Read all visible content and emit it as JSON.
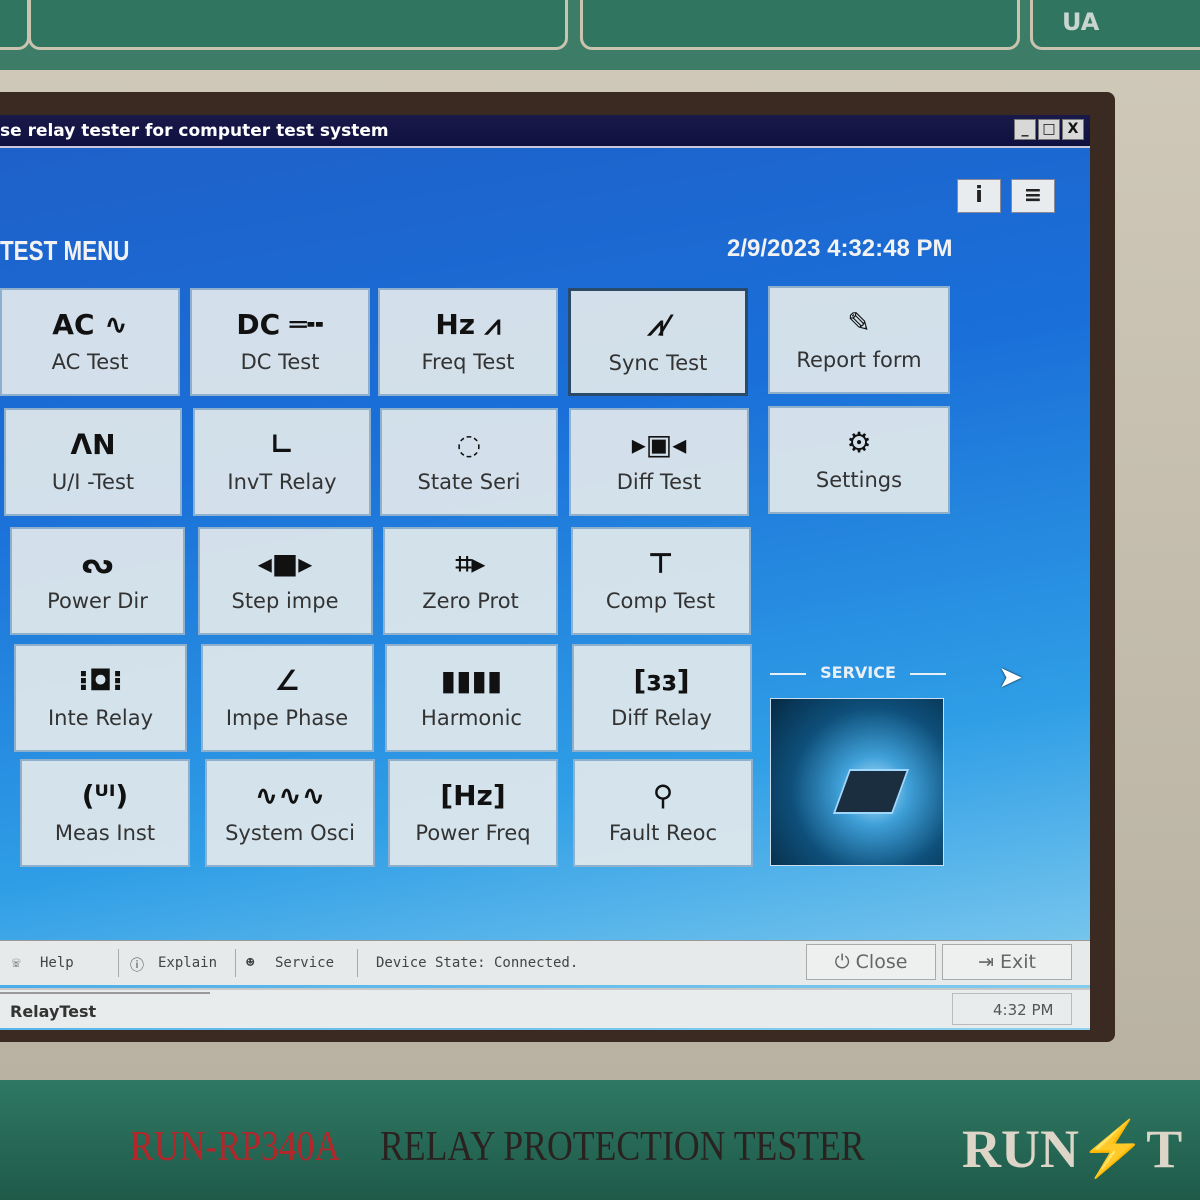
{
  "device": {
    "top_label": "UA",
    "model": "RUN-RP340A",
    "product": "RELAY PROTECTION TESTER",
    "logo": "RUN⚡T"
  },
  "window": {
    "title": "se relay tester for computer test system",
    "controls": [
      "_",
      "□",
      "X"
    ]
  },
  "header": {
    "menu_title": "TEST MENU",
    "datetime": "2/9/2023 4:32:48 PM",
    "info_label": "i",
    "menu_label": "≡"
  },
  "tiles": [
    {
      "label": "AC Test",
      "icon": "ac-wave-icon",
      "glyph": "AC ∿"
    },
    {
      "label": "DC Test",
      "icon": "dc-icon",
      "glyph": "DC ═╍"
    },
    {
      "label": "Freq Test",
      "icon": "hz-pulse-icon",
      "glyph": "Hz ⩘"
    },
    {
      "label": "Sync Test",
      "icon": "sync-pulse-icon",
      "glyph": "⩘⁄",
      "selected": true
    },
    {
      "label": "U/I -Test",
      "icon": "ui-icon",
      "glyph": "ᐱN"
    },
    {
      "label": "InvT Relay",
      "icon": "inverse-curve-icon",
      "glyph": "∟"
    },
    {
      "label": "State Seri",
      "icon": "state-cycle-icon",
      "glyph": "◌"
    },
    {
      "label": "Diff Test",
      "icon": "diff-battery-icon",
      "glyph": "▸▣◂"
    },
    {
      "label": "Power Dir",
      "icon": "power-wave-icon",
      "glyph": "ᔓ"
    },
    {
      "label": "Step impe",
      "icon": "step-icon",
      "glyph": "◂■▸"
    },
    {
      "label": "Zero Prot",
      "icon": "zero-prot-icon",
      "glyph": "⌗▸"
    },
    {
      "label": "Comp Test",
      "icon": "hierarchy-icon",
      "glyph": "⊤"
    },
    {
      "label": "Inte Relay",
      "icon": "relay-icon",
      "glyph": "⁝◘⁝"
    },
    {
      "label": "Impe Phase",
      "icon": "phase-angle-icon",
      "glyph": "∠"
    },
    {
      "label": "Harmonic",
      "icon": "harmonic-icon",
      "glyph": "▮▮▮▮"
    },
    {
      "label": "Diff Relay",
      "icon": "diff-relay-icon",
      "glyph": "[ɜɜ]"
    },
    {
      "label": "Meas Inst",
      "icon": "meter-icon",
      "glyph": "(ᵁᴵ)"
    },
    {
      "label": "System Osci",
      "icon": "oscillation-icon",
      "glyph": "∿∿∿"
    },
    {
      "label": "Power Freq",
      "icon": "power-freq-icon",
      "glyph": "[Hz]"
    },
    {
      "label": "Fault Reoc",
      "icon": "fault-search-icon",
      "glyph": "⚲"
    }
  ],
  "side_tiles": [
    {
      "label": "Report form",
      "icon": "report-icon",
      "glyph": "✎"
    },
    {
      "label": "Settings",
      "icon": "gear-icon",
      "glyph": "⚙"
    }
  ],
  "service": {
    "label": "SERVICE"
  },
  "statusbar": {
    "help": "Help",
    "explain": "Explain",
    "service": "Service",
    "device_state": "Device State: Connected.",
    "close": "Close",
    "exit": "Exit"
  },
  "taskbar": {
    "task": "RelayTest",
    "time": "4:32 PM"
  }
}
